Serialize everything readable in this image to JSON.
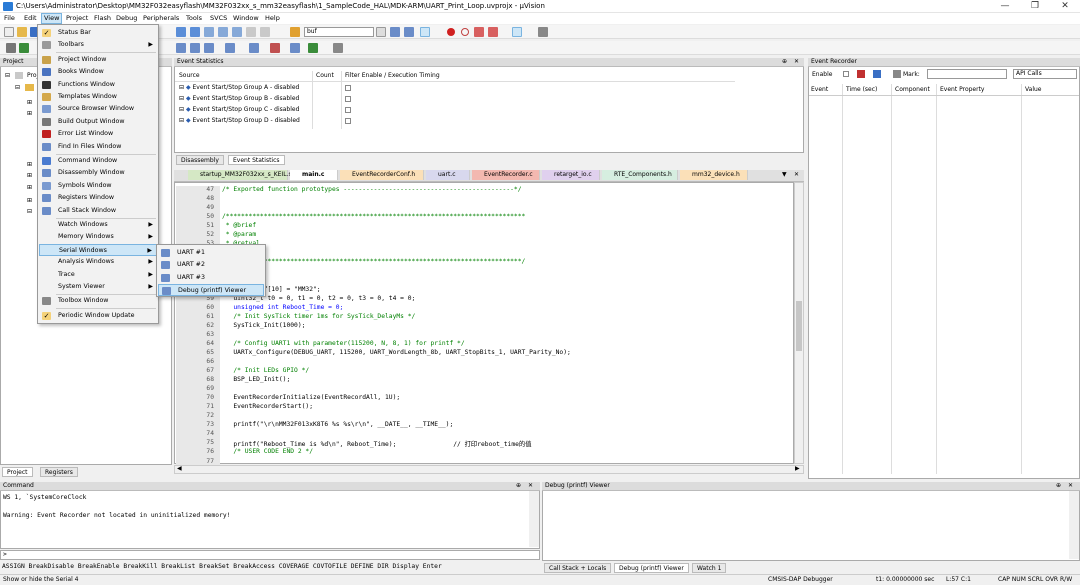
{
  "window": {
    "title": "C:\\Users\\Administrator\\Desktop\\MM32F032easyflash\\MM32F032xx_s_mm32easyflash\\1_SampleCode_HAL\\MDK-ARM\\UART_Print_Loop.uvprojx - µVision",
    "minimize": "—",
    "maximize": "❐",
    "close": "✕"
  },
  "menubar": [
    "File",
    "Edit",
    "View",
    "Project",
    "Flash",
    "Debug",
    "Peripherals",
    "Tools",
    "SVCS",
    "Window",
    "Help"
  ],
  "toolbar": {
    "find_text": "buf"
  },
  "project_panel": {
    "title": "Project",
    "root_label": "Proje",
    "tabs": [
      "Project",
      "Registers"
    ]
  },
  "view_menu": {
    "items": [
      {
        "label": "Status Bar",
        "checked": true
      },
      {
        "label": "Toolbars",
        "submenu": true
      },
      {
        "label": "Project Window"
      },
      {
        "label": "Books Window"
      },
      {
        "label": "Functions Window"
      },
      {
        "label": "Templates Window"
      },
      {
        "label": "Source Browser Window"
      },
      {
        "label": "Build Output Window"
      },
      {
        "label": "Error List Window"
      },
      {
        "label": "Find In Files Window"
      },
      {
        "label": "Command Window"
      },
      {
        "label": "Disassembly Window"
      },
      {
        "label": "Symbols Window"
      },
      {
        "label": "Registers Window"
      },
      {
        "label": "Call Stack Window"
      },
      {
        "label": "Watch Windows",
        "submenu": true
      },
      {
        "label": "Memory Windows",
        "submenu": true
      },
      {
        "label": "Serial Windows",
        "submenu": true,
        "highlighted": true
      },
      {
        "label": "Analysis Windows",
        "submenu": true
      },
      {
        "label": "Trace",
        "submenu": true
      },
      {
        "label": "System Viewer",
        "submenu": true
      },
      {
        "label": "Toolbox Window"
      },
      {
        "label": "Periodic Window Update",
        "checked": true
      }
    ],
    "submenu_arrow": "▶"
  },
  "serial_submenu": {
    "items": [
      {
        "label": "UART #1"
      },
      {
        "label": "UART #2"
      },
      {
        "label": "UART #3"
      },
      {
        "label": "Debug (printf) Viewer",
        "highlighted": true
      }
    ]
  },
  "event_statistics": {
    "title": "Event Statistics",
    "columns": [
      "Source",
      "Count",
      "Filter Enable / Execution Timing"
    ],
    "rows": [
      "Event Start/Stop Group A - disabled",
      "Event Start/Stop Group B - disabled",
      "Event Start/Stop Group C - disabled",
      "Event Start/Stop Group D - disabled"
    ],
    "tabs": [
      "Disassembly",
      "Event Statistics"
    ]
  },
  "file_tabs": [
    "startup_MM32F032xx_s_KEIL.s",
    "main.c",
    "EventRecorderConf.h",
    "uart.c",
    "EventRecorder.c",
    "retarget_io.c",
    "RTE_Components.h",
    "mm32_device.h"
  ],
  "editor": {
    "line_numbers": [
      "47",
      "48",
      "49",
      "50",
      "51",
      "52",
      "53",
      "54",
      "55",
      "56",
      "57",
      "58",
      "59",
      "60",
      "61",
      "62",
      "63",
      "64",
      "65",
      "66",
      "67",
      "68",
      "69",
      "70",
      "71",
      "72",
      "73",
      "74",
      "75",
      "76",
      "77"
    ],
    "lines": [
      {
        "t": "/* Exported function prototypes ---------------------------------------------*/",
        "c": "cm"
      },
      {
        "t": "",
        "c": ""
      },
      {
        "t": "",
        "c": ""
      },
      {
        "t": "/*******************************************************************************",
        "c": "cm"
      },
      {
        "t": " * @brief",
        "c": "cm"
      },
      {
        "t": " * @param",
        "c": "cm"
      },
      {
        "t": " * @retval",
        "c": "cm"
      },
      {
        "t": "    tion",
        "c": "cm"
      },
      {
        "t": "    ***************************************************************************/",
        "c": "cm"
      },
      {
        "t": "   void)",
        "c": ""
      },
      {
        "t": "",
        "c": ""
      },
      {
        "t": "   t s_ucBuf[10] = \"MM32\";",
        "c": ""
      },
      {
        "t": "   uint32_t t0 = 0, t1 = 0, t2 = 0, t3 = 0, t4 = 0;",
        "c": ""
      },
      {
        "t": "   unsigned int Reboot_Time = 0;",
        "c": "kwl"
      },
      {
        "t": "   /* Init SysTick timer 1ms for SysTick_DelayMs */",
        "c": "cm"
      },
      {
        "t": "   SysTick_Init(1000);",
        "c": ""
      },
      {
        "t": "",
        "c": ""
      },
      {
        "t": "   /* Config UART1 with parameter(115200, N, 8, 1) for printf */",
        "c": "cm"
      },
      {
        "t": "   UARTx_Configure(DEBUG_UART, 115200, UART_WordLength_8b, UART_StopBits_1, UART_Parity_No);",
        "c": ""
      },
      {
        "t": "",
        "c": ""
      },
      {
        "t": "   /* Init LEDs GPIO */",
        "c": "cm"
      },
      {
        "t": "   BSP_LED_Init();",
        "c": ""
      },
      {
        "t": "",
        "c": ""
      },
      {
        "t": "   EventRecorderInitialize(EventRecordAll, 1U);",
        "c": ""
      },
      {
        "t": "   EventRecorderStart();",
        "c": ""
      },
      {
        "t": "",
        "c": ""
      },
      {
        "t": "   printf(\"\\r\\nMM32F013xK8T6 %s %s\\r\\n\", __DATE__, __TIME__);",
        "c": ""
      },
      {
        "t": "",
        "c": ""
      },
      {
        "t": "   printf(\"Reboot_Time is %d\\n\", Reboot_Time);               // 打印reboot_time的值",
        "c": ""
      },
      {
        "t": "   /* USER CODE END 2 */",
        "c": "cm"
      },
      {
        "t": "",
        "c": ""
      }
    ]
  },
  "event_recorder": {
    "title": "Event Recorder",
    "enable_label": "Enable",
    "mark_label": "Mark:",
    "filter_value": "API Calls",
    "columns": [
      "Event",
      "Time (sec)",
      "Component",
      "Event Property",
      "Value"
    ]
  },
  "command": {
    "title": "Command",
    "lines": [
      "WS 1, `SystemCoreClock",
      "",
      "Warning: Event Recorder not located in uninitialized memory!"
    ],
    "prompt": ">",
    "help": "ASSIGN BreakDisable BreakEnable BreakKill BreakList BreakSet BreakAccess COVERAGE COVTOFILE DEFINE DIR Display Enter"
  },
  "debug_viewer": {
    "title": "Debug (printf) Viewer",
    "tabs": [
      "Call Stack + Locals",
      "Debug (printf) Viewer",
      "Watch 1"
    ]
  },
  "statusbar": {
    "message": "Show or hide the Serial 4",
    "debugger": "CMSIS-DAP Debugger",
    "time": "t1: 0.00000000 sec",
    "position": "L:57 C:1",
    "indicators": "CAP NUM SCRL OVR R/W"
  }
}
